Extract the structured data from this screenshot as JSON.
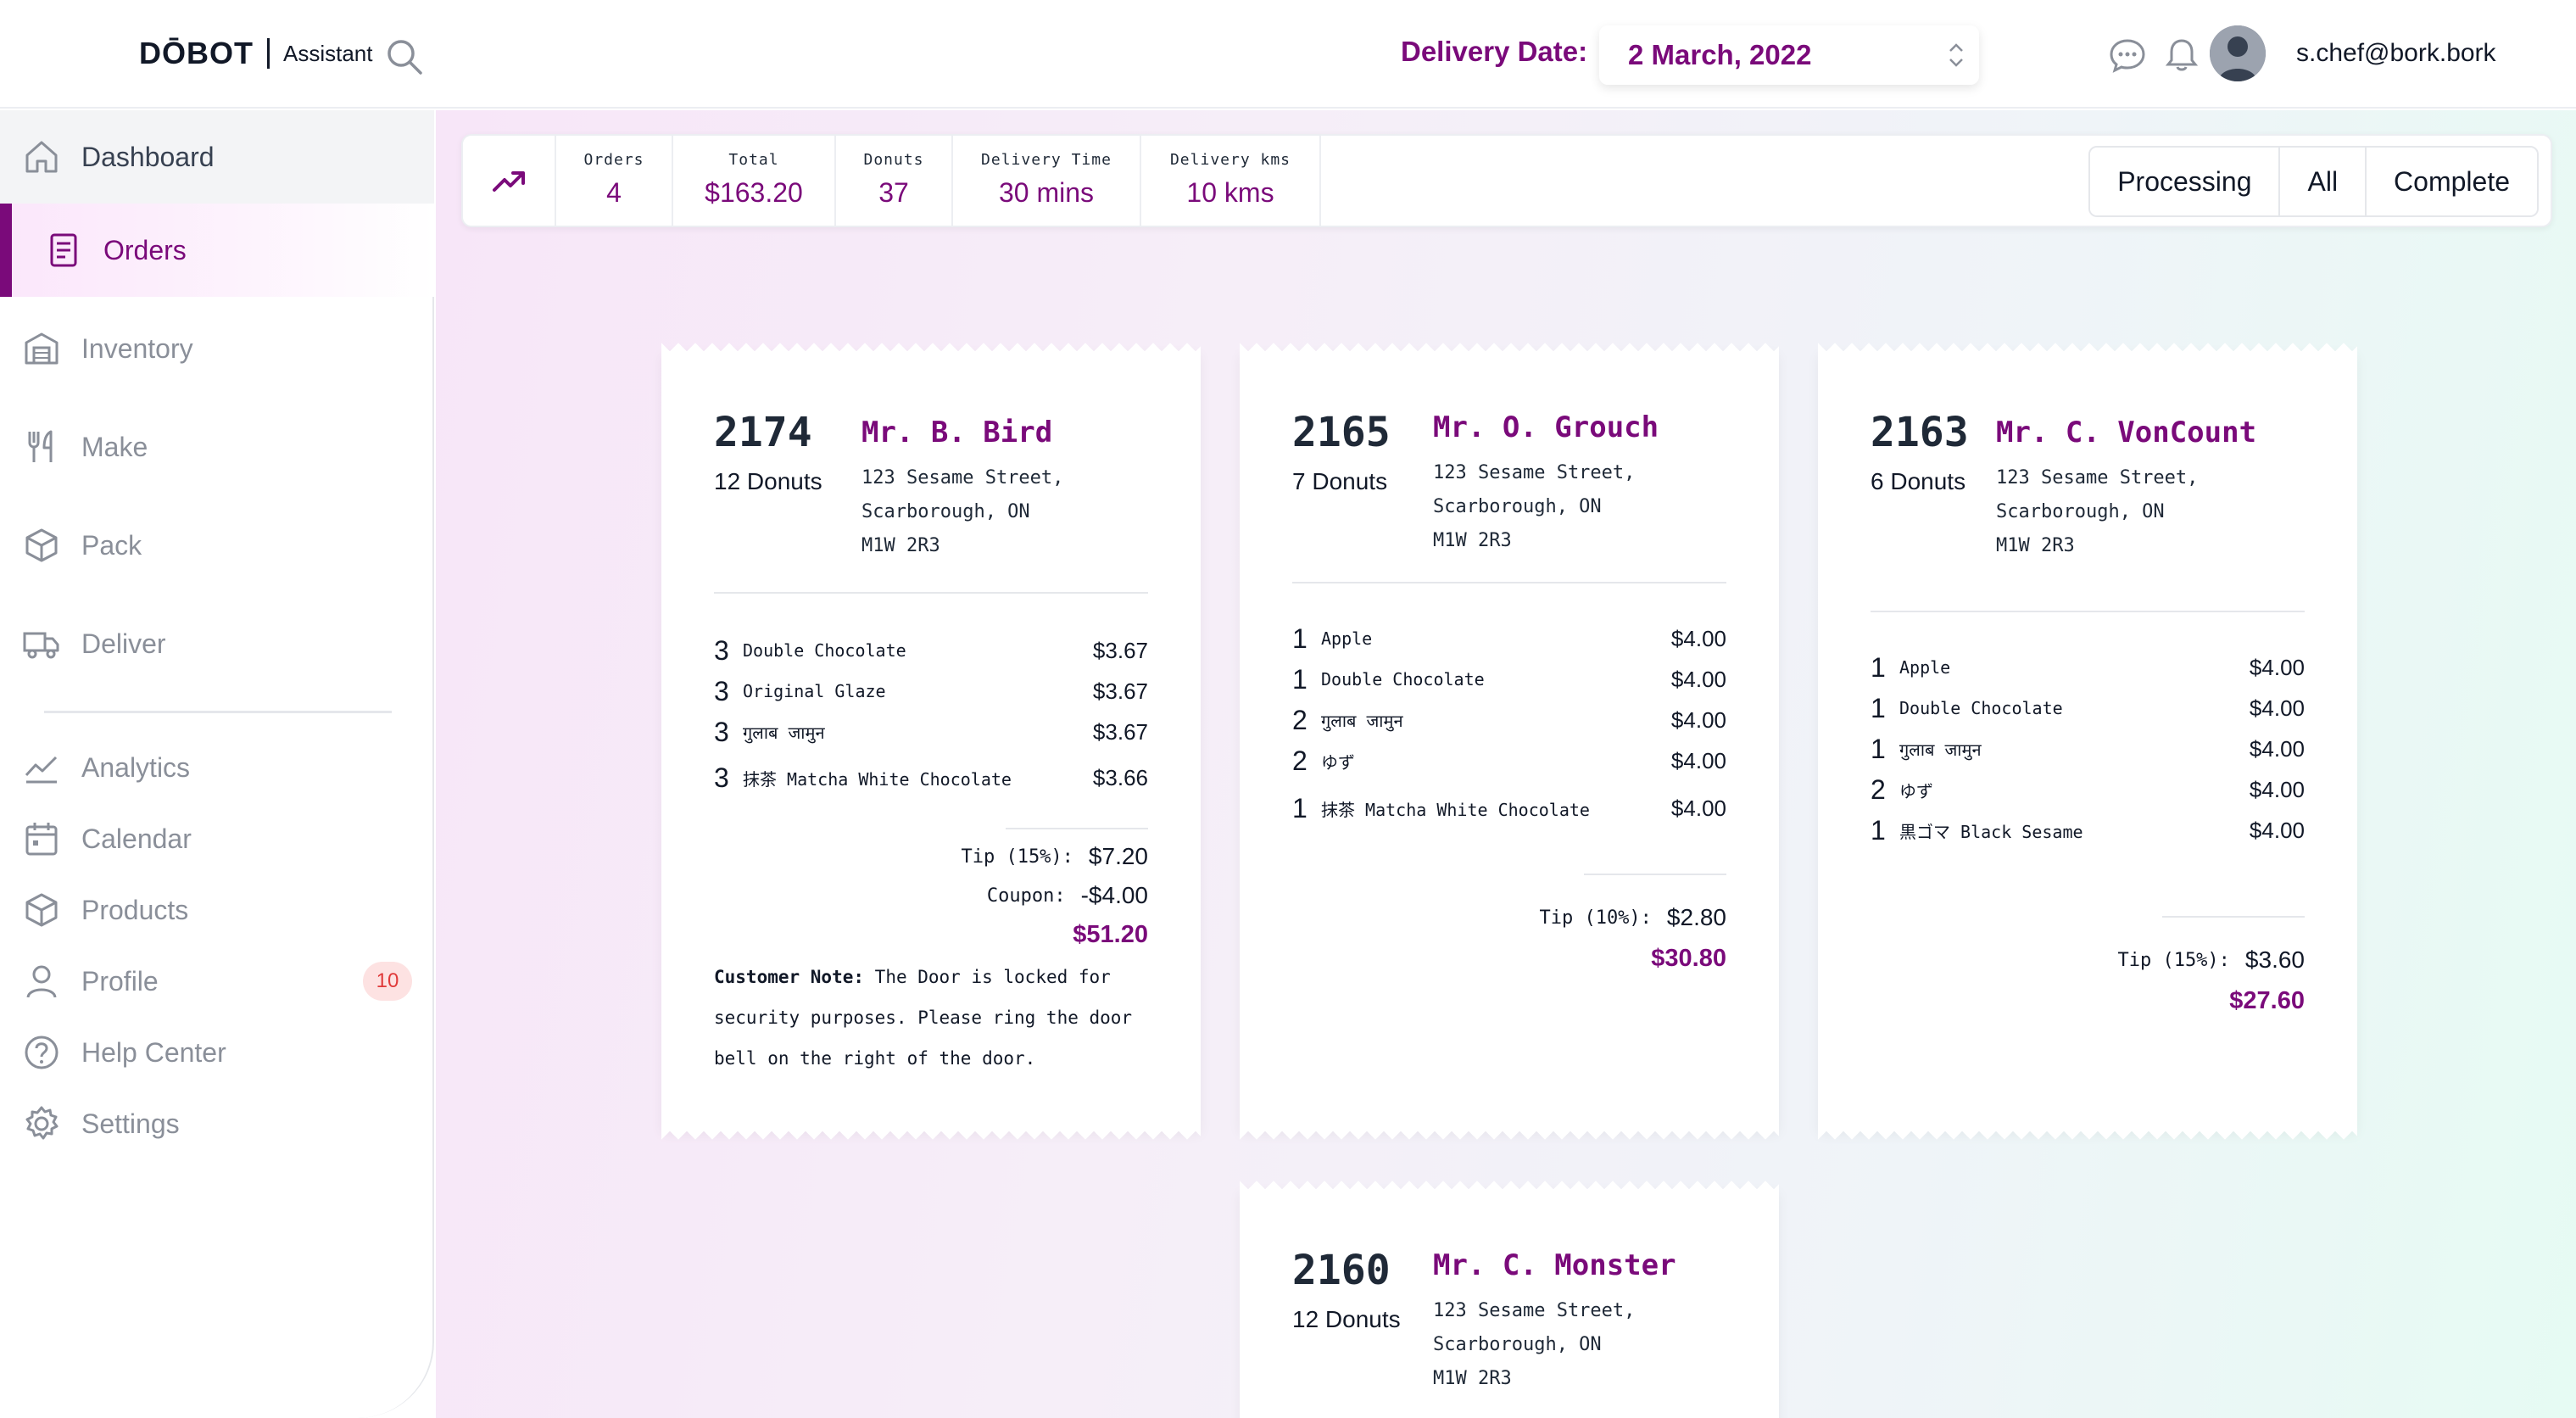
{
  "app": {
    "logo": "DŌBOT",
    "subtitle": "Assistant"
  },
  "header": {
    "delivery_label": "Delivery Date:",
    "delivery_value": "2 March, 2022",
    "user_email": "s.chef@bork.bork"
  },
  "sidebar": {
    "items": [
      {
        "label": "Dashboard",
        "icon": "home-icon"
      },
      {
        "label": "Orders",
        "icon": "document-icon"
      },
      {
        "label": "Inventory",
        "icon": "warehouse-icon"
      },
      {
        "label": "Make",
        "icon": "utensils-icon"
      },
      {
        "label": "Pack",
        "icon": "box-icon"
      },
      {
        "label": "Deliver",
        "icon": "truck-icon"
      },
      {
        "label": "Analytics",
        "icon": "chart-line-icon"
      },
      {
        "label": "Calendar",
        "icon": "calendar-icon"
      },
      {
        "label": "Products",
        "icon": "cube-icon"
      },
      {
        "label": "Profile",
        "icon": "user-icon",
        "badge": "10"
      },
      {
        "label": "Help Center",
        "icon": "help-icon"
      },
      {
        "label": "Settings",
        "icon": "gear-icon"
      }
    ]
  },
  "stats": [
    {
      "label": "Orders",
      "value": "4"
    },
    {
      "label": "Total",
      "value": "$163.20"
    },
    {
      "label": "Donuts",
      "value": "37"
    },
    {
      "label": "Delivery Time",
      "value": "30 mins"
    },
    {
      "label": "Delivery kms",
      "value": "10 kms"
    }
  ],
  "filters": [
    "Processing",
    "All",
    "Complete"
  ],
  "colors": {
    "accent": "#7a0a7a",
    "badge_bg": "#fde2e2",
    "badge_text": "#e03a3a"
  },
  "orders": [
    {
      "number": "2174",
      "count": "12 Donuts",
      "name": "Mr. B. Bird",
      "address": [
        "123 Sesame Street,",
        "Scarborough, ON",
        "M1W 2R3"
      ],
      "items": [
        {
          "qty": "3",
          "name": "Double Chocolate",
          "price": "$3.67"
        },
        {
          "qty": "3",
          "name": "Original Glaze",
          "price": "$3.67"
        },
        {
          "qty": "3",
          "name": "गुलाब जामुन",
          "price": "$3.67"
        },
        {
          "qty": "3",
          "name": "抹茶 Matcha White Chocolate",
          "price": "$3.66"
        }
      ],
      "tip_label": "Tip (15%):",
      "tip": "$7.20",
      "coupon_label": "Coupon:",
      "coupon": "-$4.00",
      "total": "$51.20",
      "note_label": "Customer Note:",
      "note": "The Door is locked for security purposes. Please ring the door bell on the right of the door."
    },
    {
      "number": "2165",
      "count": "7 Donuts",
      "name": "Mr. O. Grouch",
      "address": [
        "123 Sesame Street,",
        "Scarborough, ON",
        "M1W 2R3"
      ],
      "items": [
        {
          "qty": "1",
          "name": "Apple",
          "price": "$4.00"
        },
        {
          "qty": "1",
          "name": "Double Chocolate",
          "price": "$4.00"
        },
        {
          "qty": "2",
          "name": "गुलाब जामुन",
          "price": "$4.00"
        },
        {
          "qty": "2",
          "name": "ゆず",
          "price": "$4.00"
        },
        {
          "qty": "1",
          "name": "抹茶 Matcha White Chocolate",
          "price": "$4.00"
        }
      ],
      "tip_label": "Tip (10%):",
      "tip": "$2.80",
      "total": "$30.80"
    },
    {
      "number": "2163",
      "count": "6 Donuts",
      "name": "Mr. C. VonCount",
      "address": [
        "123 Sesame Street,",
        "Scarborough, ON",
        "M1W 2R3"
      ],
      "items": [
        {
          "qty": "1",
          "name": "Apple",
          "price": "$4.00"
        },
        {
          "qty": "1",
          "name": "Double Chocolate",
          "price": "$4.00"
        },
        {
          "qty": "1",
          "name": "गुलाब जामुन",
          "price": "$4.00"
        },
        {
          "qty": "2",
          "name": "ゆず",
          "price": "$4.00"
        },
        {
          "qty": "1",
          "name": "黒ゴマ Black Sesame",
          "price": "$4.00"
        }
      ],
      "tip_label": "Tip (15%):",
      "tip": "$3.60",
      "total": "$27.60"
    },
    {
      "number": "2160",
      "count": "12 Donuts",
      "name": "Mr. C. Monster",
      "address": [
        "123 Sesame Street,",
        "Scarborough, ON",
        "M1W 2R3"
      ]
    }
  ]
}
